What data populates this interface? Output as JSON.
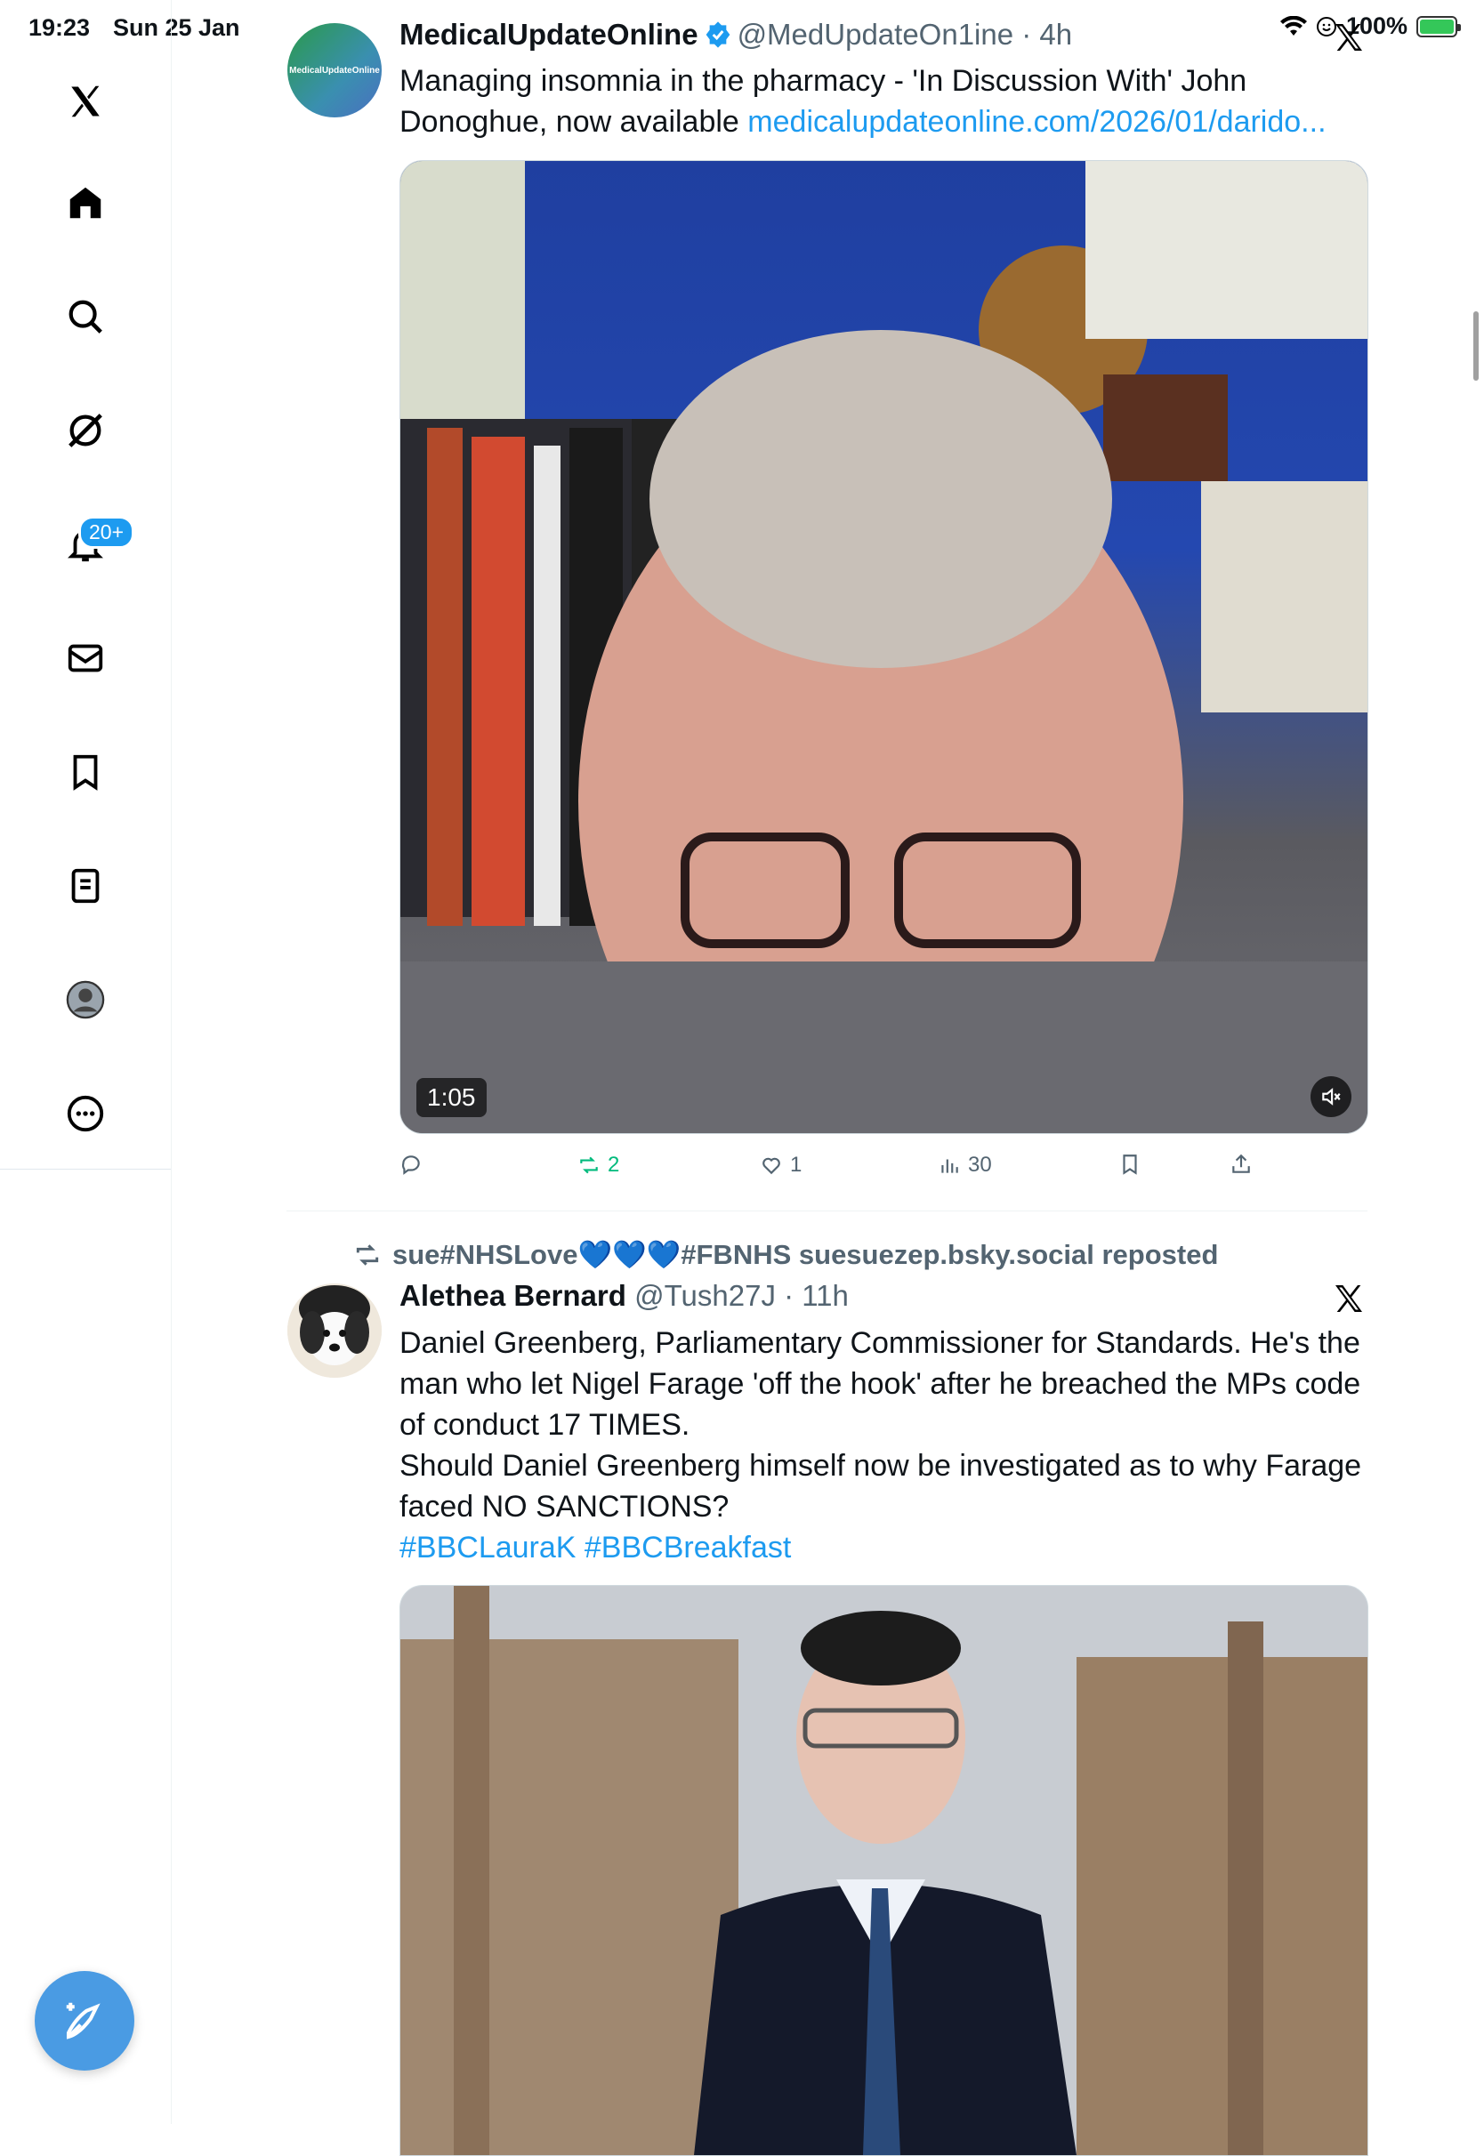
{
  "status_bar": {
    "time": "19:23",
    "date": "Sun 25 Jan",
    "battery": "100%"
  },
  "sidebar": {
    "items": [
      {
        "name": "home",
        "icon": "home-icon"
      },
      {
        "name": "explore",
        "icon": "search-icon"
      },
      {
        "name": "grok",
        "icon": "grok-icon"
      },
      {
        "name": "notifications",
        "icon": "bell-icon",
        "badge": "20+"
      },
      {
        "name": "messages",
        "icon": "mail-icon"
      },
      {
        "name": "bookmarks",
        "icon": "bookmark-icon"
      },
      {
        "name": "lists",
        "icon": "list-icon"
      },
      {
        "name": "profile",
        "icon": "profile-icon"
      },
      {
        "name": "more",
        "icon": "more-icon"
      }
    ],
    "compose_icon": "compose-icon"
  },
  "tweets": [
    {
      "name": "MedicalUpdateOnline",
      "handle": "@MedUpdateOn1ine",
      "time": "4h",
      "avatar_text": "MedicalUpdateOnline",
      "text": "Managing insomnia in the pharmacy - 'In Discussion With' John Donoghue, now available ",
      "link": "medicalupdateonline.com/2026/01/darido...",
      "video_duration": "1:05",
      "replies": "",
      "reposts": "2",
      "likes": "1",
      "views": "30"
    },
    {
      "repost_by": "sue#NHSLove💙💙💙#FBNHS suesuezep.bsky.social reposted",
      "name": "Alethea Bernard",
      "handle": "@Tush27J",
      "time": "11h",
      "text_lines": [
        "Daniel Greenberg, Parliamentary Commissioner for Standards. He's the man who let Nigel Farage 'off the hook' after he breached the MPs code of conduct 17 TIMES.",
        "Should Daniel Greenberg himself now be investigated as to why Farage faced NO SANCTIONS?"
      ],
      "hashtags": "#BBCLauraK #BBCBreakfast"
    }
  ],
  "colors": {
    "accent": "#1d9bf0",
    "repost_green": "#00ba7c",
    "muted": "#536471"
  }
}
